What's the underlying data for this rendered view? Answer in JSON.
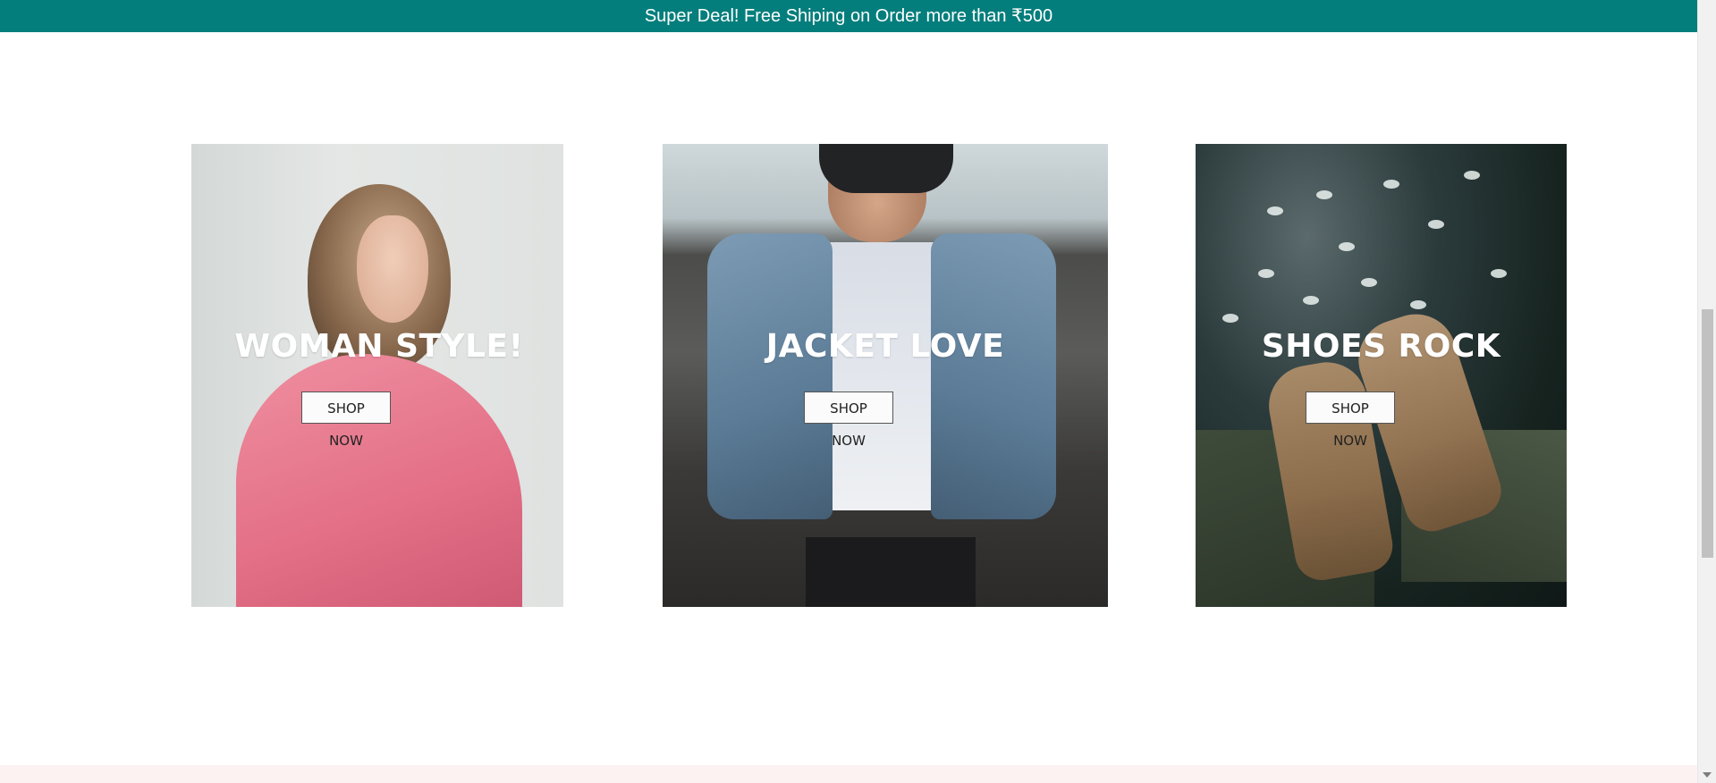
{
  "promo": {
    "text": "Super Deal! Free Shiping on Order more than ₹500",
    "background": "#047e7c"
  },
  "categories": [
    {
      "title": "WOMAN STYLE!",
      "button": "SHOP NOW",
      "image": "woman-in-pink-shirt"
    },
    {
      "title": "JACKET LOVE",
      "button": "SHOP NOW",
      "image": "man-in-denim-jacket"
    },
    {
      "title": "SHOES ROCK",
      "button": "SHOP NOW",
      "image": "boots-over-water"
    }
  ],
  "footer": {
    "background": "#fcf2f1"
  }
}
